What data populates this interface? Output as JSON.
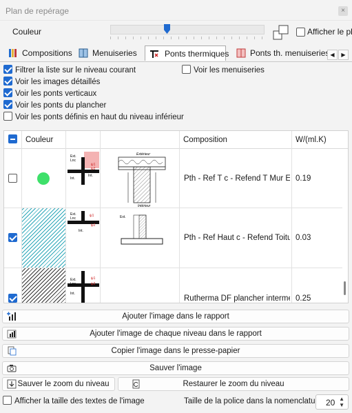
{
  "window": {
    "title": "Plan de repérage",
    "close_glyph": "×"
  },
  "color_row": {
    "label": "Couleur",
    "show_plan_label": "Afficher le plan"
  },
  "tabs": [
    {
      "label": "Compositions",
      "icon": "compositions-icon"
    },
    {
      "label": "Menuiseries",
      "icon": "menuiseries-icon"
    },
    {
      "label": "Ponts thermiques",
      "icon": "thermal-bridge-icon",
      "active": true
    },
    {
      "label": "Ponts th. menuiseries",
      "icon": "window-bridge-icon"
    }
  ],
  "tab_nav": {
    "prev": "◀",
    "next": "▶"
  },
  "options": {
    "filter_level": {
      "label": "Filtrer la liste sur le niveau courant",
      "checked": true
    },
    "show_detailed": {
      "label": "Voir les images détaillés",
      "checked": true
    },
    "show_vertical": {
      "label": "Voir les ponts verticaux",
      "checked": true
    },
    "show_floor": {
      "label": "Voir les ponts du plancher",
      "checked": true
    },
    "show_top": {
      "label": "Voir les ponts définis en haut du niveau inférieur",
      "checked": false
    },
    "show_joinery": {
      "label": "Voir les menuiseries",
      "checked": false
    }
  },
  "table": {
    "columns": [
      "Couleur",
      "Composition",
      "W/(ml.K)"
    ],
    "rows": [
      {
        "checked": false,
        "color": "#3ee06a",
        "swatch": "dot",
        "composition": "Pth - Ref T c - Refend T Mur Exte",
        "value": "0.19",
        "plan_caption_top": "Extérieur",
        "plan_caption_bottom": "Intérieur"
      },
      {
        "checked": true,
        "color": "#2aa6b8",
        "swatch": "hatch-cyan",
        "composition": "Pth - Ref Haut c - Refend Toiture",
        "value": "0.03",
        "plan_caption_top": "Ext.",
        "plan_caption_bottom": ""
      },
      {
        "checked": true,
        "color": "#333333",
        "swatch": "hatch-dark",
        "composition": "Rutherma DF plancher intermédia",
        "value": "0.25"
      }
    ],
    "thumb_labels": {
      "ext": "Ext.",
      "lnc": "Lnc",
      "int": "Int.",
      "psi1": "ψ1",
      "psi2": "ψ2"
    }
  },
  "buttons": {
    "add_image": "Ajouter l'image dans le rapport",
    "add_each_level": "Ajouter l'image de chaque niveau dans le rapport",
    "copy_clipboard": "Copier l'image dans le presse-papier",
    "save_image": "Sauver l'image",
    "save_zoom": "Sauver le zoom du niveau",
    "restore_zoom": "Restaurer le zoom du niveau"
  },
  "footer": {
    "show_text_size": "Afficher la taille des textes de l'image",
    "font_size_label": "Taille de la police dans la nomenclature",
    "font_size_value": "20"
  },
  "colors": {
    "accent": "#1f6ad0",
    "background": "#f3f3f3"
  }
}
